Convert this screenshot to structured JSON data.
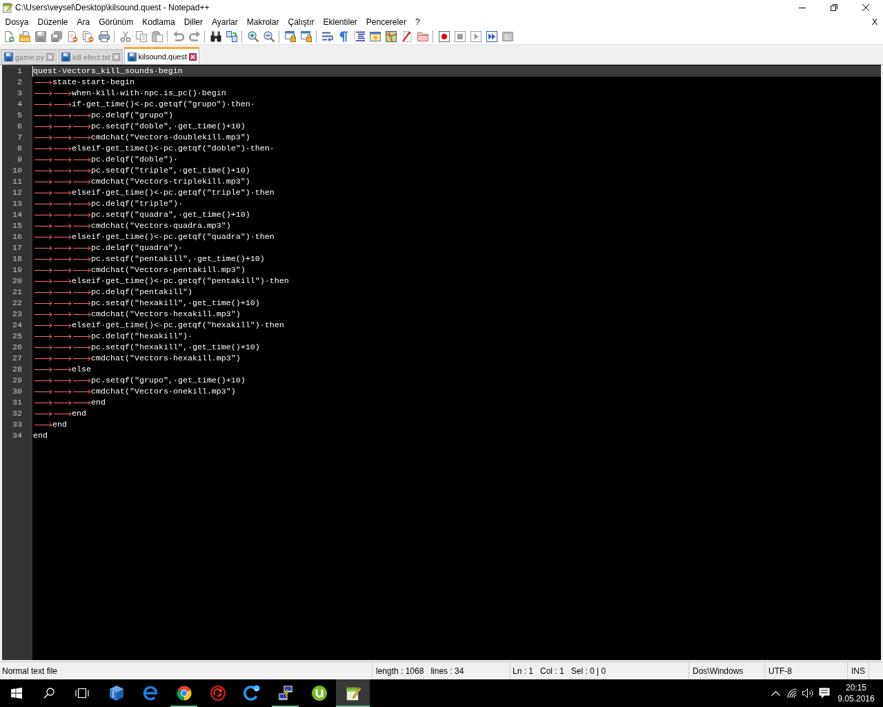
{
  "window": {
    "title": "C:\\Users\\veysel\\Desktop\\kilsound.quest - Notepad++"
  },
  "menu": {
    "items": [
      "Dosya",
      "Düzenle",
      "Ara",
      "Görünüm",
      "Kodlama",
      "Diller",
      "Ayarlar",
      "Makrolar",
      "Çalıştır",
      "Eklentiler",
      "Pencereler",
      "?"
    ],
    "close_document": "X"
  },
  "toolbar": {
    "groups": [
      [
        {
          "disabled": false
        },
        {
          "disabled": false
        },
        {
          "disabled": true
        },
        {
          "disabled": true
        },
        {
          "disabled": false
        },
        {
          "disabled": false
        },
        {
          "disabled": false
        }
      ],
      [
        {
          "disabled": true
        },
        {
          "disabled": true
        },
        {
          "disabled": true
        }
      ],
      [
        {
          "disabled": true
        },
        {
          "disabled": true
        }
      ],
      [
        {
          "disabled": false
        },
        {
          "disabled": false
        }
      ],
      [
        {
          "disabled": false
        },
        {
          "disabled": false
        }
      ],
      [
        {
          "disabled": false
        },
        {
          "disabled": false
        }
      ],
      [
        {
          "disabled": false
        },
        {
          "disabled": false
        },
        {
          "disabled": false
        },
        {
          "disabled": false
        },
        {
          "disabled": false
        },
        {
          "disabled": false
        },
        {
          "disabled": false
        }
      ],
      [
        {
          "disabled": false
        },
        {
          "disabled": true
        },
        {
          "disabled": true
        },
        {
          "disabled": false
        },
        {
          "disabled": true
        }
      ]
    ]
  },
  "tabs": [
    {
      "label": "game.py",
      "selected": false
    },
    {
      "label": "kill efect.txt",
      "selected": false
    },
    {
      "label": "kilsound.quest",
      "selected": true
    }
  ],
  "editor": {
    "lines": [
      {
        "number": "1",
        "current": true,
        "text": "quest·Vectors_kill_sounds·begin"
      },
      {
        "number": "2",
        "current": false,
        "tabs": [
          {
            "kind": "tab"
          }
        ],
        "text": "state·start·begin"
      },
      {
        "number": "3",
        "current": false,
        "tabs": [
          {
            "kind": "tab"
          },
          {
            "kind": "tab"
          }
        ],
        "text": "when·kill·with·npc.is_pc()·begin"
      },
      {
        "number": "4",
        "current": false,
        "tabs": [
          {
            "kind": "tab"
          },
          {
            "kind": "tab"
          }
        ],
        "text": "if·get_time()<·pc.getqf(\"grupo\")·then·"
      },
      {
        "number": "5",
        "current": false,
        "tabs": [
          {
            "kind": "tab"
          },
          {
            "kind": "tab"
          },
          {
            "kind": "tab"
          }
        ],
        "text": "pc.delqf(\"grupo\")"
      },
      {
        "number": "6",
        "current": false,
        "tabs": [
          {
            "kind": "tab"
          },
          {
            "kind": "tab"
          },
          {
            "kind": "tab"
          }
        ],
        "text": "pc.setqf(\"doble\",·get_time()+10)"
      },
      {
        "number": "7",
        "current": false,
        "tabs": [
          {
            "kind": "tab"
          },
          {
            "kind": "tab"
          },
          {
            "kind": "tab"
          }
        ],
        "text": "cmdchat(\"Vectors·doublekill.mp3\")"
      },
      {
        "number": "8",
        "current": false,
        "tabs": [
          {
            "kind": "tab"
          },
          {
            "kind": "tab"
          }
        ],
        "text": "elseif·get_time()<·pc.getqf(\"doble\")·then·"
      },
      {
        "number": "9",
        "current": false,
        "tabs": [
          {
            "kind": "tab"
          },
          {
            "kind": "tab"
          },
          {
            "kind": "tab"
          }
        ],
        "text": "pc.delqf(\"doble\")·"
      },
      {
        "number": "10",
        "current": false,
        "tabs": [
          {
            "kind": "tab"
          },
          {
            "kind": "tab"
          },
          {
            "kind": "tab"
          }
        ],
        "text": "pc.setqf(\"triple\",·get_time()+10)"
      },
      {
        "number": "11",
        "current": false,
        "tabs": [
          {
            "kind": "tab"
          },
          {
            "kind": "tab"
          },
          {
            "kind": "tab"
          }
        ],
        "text": "cmdchat(\"Vectors·triplekill.mp3\")"
      },
      {
        "number": "12",
        "current": false,
        "tabs": [
          {
            "kind": "tab"
          },
          {
            "kind": "tab"
          }
        ],
        "text": "elseif·get_time()<·pc.getqf(\"triple\")·then"
      },
      {
        "number": "13",
        "current": false,
        "tabs": [
          {
            "kind": "tab"
          },
          {
            "kind": "tab"
          },
          {
            "kind": "tab"
          }
        ],
        "text": "pc.delqf(\"triple\")·"
      },
      {
        "number": "14",
        "current": false,
        "tabs": [
          {
            "kind": "tab"
          },
          {
            "kind": "tab"
          },
          {
            "kind": "tab"
          }
        ],
        "text": "pc.setqf(\"quadra\",·get_time()+10)"
      },
      {
        "number": "15",
        "current": false,
        "tabs": [
          {
            "kind": "tab"
          },
          {
            "kind": "tab"
          },
          {
            "kind": "tab"
          }
        ],
        "text": "cmdchat(\"Vectors·quadra.mp3\")"
      },
      {
        "number": "16",
        "current": false,
        "tabs": [
          {
            "kind": "tab"
          },
          {
            "kind": "tab"
          }
        ],
        "text": "elseif·get_time()<·pc.getqf(\"quadra\")·then"
      },
      {
        "number": "17",
        "current": false,
        "tabs": [
          {
            "kind": "tab"
          },
          {
            "kind": "tab"
          },
          {
            "kind": "tab"
          }
        ],
        "text": "pc.delqf(\"quadra\")·"
      },
      {
        "number": "18",
        "current": false,
        "tabs": [
          {
            "kind": "tab"
          },
          {
            "kind": "tab"
          },
          {
            "kind": "tab"
          }
        ],
        "text": "pc.setqf(\"pentakill\",·get_time()+10)"
      },
      {
        "number": "19",
        "current": false,
        "tabs": [
          {
            "kind": "tab"
          },
          {
            "kind": "tab"
          },
          {
            "kind": "tab"
          }
        ],
        "text": "cmdchat(\"Vectors·pentakill.mp3\")"
      },
      {
        "number": "20",
        "current": false,
        "tabs": [
          {
            "kind": "tab"
          },
          {
            "kind": "tab"
          }
        ],
        "text": "elseif·get_time()<·pc.getqf(\"pentakill\")·then"
      },
      {
        "number": "21",
        "current": false,
        "tabs": [
          {
            "kind": "tab"
          },
          {
            "kind": "tab"
          },
          {
            "kind": "tab"
          }
        ],
        "text": "pc.delqf(\"pentakill\")"
      },
      {
        "number": "22",
        "current": false,
        "tabs": [
          {
            "kind": "tab"
          },
          {
            "kind": "tab"
          },
          {
            "kind": "tab"
          }
        ],
        "text": "pc.setqf(\"hexakill\",·get_time()+10)"
      },
      {
        "number": "23",
        "current": false,
        "tabs": [
          {
            "kind": "tab"
          },
          {
            "kind": "tab"
          },
          {
            "kind": "tab"
          }
        ],
        "text": "cmdchat(\"Vectors·hexakill.mp3\")"
      },
      {
        "number": "24",
        "current": false,
        "tabs": [
          {
            "kind": "tab"
          },
          {
            "kind": "tab"
          }
        ],
        "text": "elseif·get_time()<·pc.getqf(\"hexakill\")·then"
      },
      {
        "number": "25",
        "current": false,
        "tabs": [
          {
            "kind": "tab"
          },
          {
            "kind": "tab"
          },
          {
            "kind": "tab"
          }
        ],
        "text": "pc.delqf(\"hexakill\")·"
      },
      {
        "number": "26",
        "current": false,
        "tabs": [
          {
            "kind": "tab"
          },
          {
            "kind": "tab"
          },
          {
            "kind": "tab"
          }
        ],
        "text": "pc.setqf(\"hexakill\",·get_time()+10)"
      },
      {
        "number": "27",
        "current": false,
        "tabs": [
          {
            "kind": "tab"
          },
          {
            "kind": "tab"
          },
          {
            "kind": "tab"
          }
        ],
        "text": "cmdchat(\"Vectors·hexakill.mp3\")"
      },
      {
        "number": "28",
        "current": false,
        "tabs": [
          {
            "kind": "tab"
          },
          {
            "kind": "tab"
          }
        ],
        "text": "else"
      },
      {
        "number": "29",
        "current": false,
        "tabs": [
          {
            "kind": "tab"
          },
          {
            "kind": "tab"
          },
          {
            "kind": "tab"
          }
        ],
        "text": "pc.setqf(\"grupo\",·get_time()+10)"
      },
      {
        "number": "30",
        "current": false,
        "tabs": [
          {
            "kind": "tab"
          },
          {
            "kind": "tab"
          },
          {
            "kind": "tab"
          }
        ],
        "text": "cmdchat(\"Vectors·onekill.mp3\")"
      },
      {
        "number": "31",
        "current": false,
        "tabs": [
          {
            "kind": "tab"
          },
          {
            "kind": "tab"
          },
          {
            "kind": "tab"
          }
        ],
        "text": "end"
      },
      {
        "number": "32",
        "current": false,
        "tabs": [
          {
            "kind": "tab"
          },
          {
            "kind": "tab"
          }
        ],
        "text": "end"
      },
      {
        "number": "33",
        "current": false,
        "tabs": [
          {
            "kind": "tab"
          }
        ],
        "text": "end"
      },
      {
        "number": "34",
        "current": false,
        "text": "end"
      }
    ]
  },
  "status_bar": {
    "file_type": "Normal text file",
    "length": "length : 1068",
    "lines": "lines : 34",
    "line": "Ln : 1",
    "column": "Col : 1",
    "selection": "Sel : 0 | 0",
    "line_ending": "Dos\\Windows",
    "encoding": "UTF-8",
    "mode": "INS"
  },
  "taskbar": {
    "apps": [
      {
        "running": false,
        "selected": false
      },
      {
        "running": false,
        "selected": false
      },
      {
        "running": true,
        "selected": false
      },
      {
        "running": false,
        "selected": false
      },
      {
        "running": false,
        "selected": false
      },
      {
        "running": true,
        "selected": false
      },
      {
        "running": false,
        "selected": false
      },
      {
        "running": true,
        "selected": true
      }
    ],
    "clock": {
      "time": "20:15",
      "date": "9.05.2016"
    }
  }
}
